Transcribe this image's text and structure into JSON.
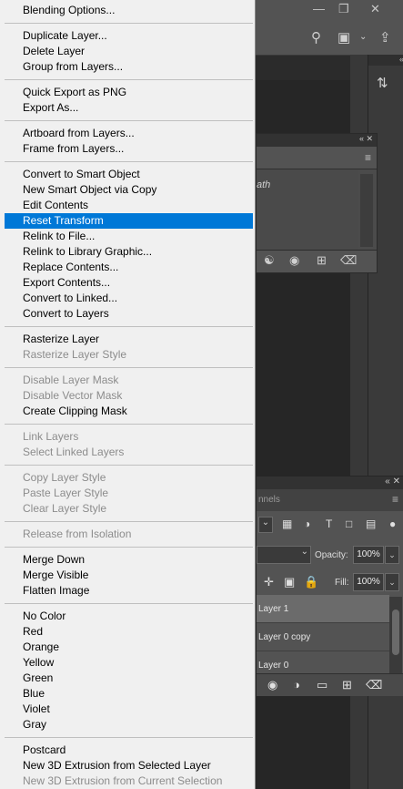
{
  "menu": {
    "items": [
      {
        "label": "Blending Options...",
        "state": "enabled"
      },
      {
        "label": "Duplicate Layer...",
        "state": "enabled"
      },
      {
        "label": "Delete Layer",
        "state": "enabled"
      },
      {
        "label": "Group from Layers...",
        "state": "enabled"
      },
      {
        "label": "Quick Export as PNG",
        "state": "enabled"
      },
      {
        "label": "Export As...",
        "state": "enabled"
      },
      {
        "label": "Artboard from Layers...",
        "state": "enabled"
      },
      {
        "label": "Frame from Layers...",
        "state": "enabled"
      },
      {
        "label": "Convert to Smart Object",
        "state": "enabled"
      },
      {
        "label": "New Smart Object via Copy",
        "state": "enabled"
      },
      {
        "label": "Edit Contents",
        "state": "enabled"
      },
      {
        "label": "Reset Transform",
        "state": "highlighted"
      },
      {
        "label": "Relink to File...",
        "state": "enabled"
      },
      {
        "label": "Relink to Library Graphic...",
        "state": "enabled"
      },
      {
        "label": "Replace Contents...",
        "state": "enabled"
      },
      {
        "label": "Export Contents...",
        "state": "enabled"
      },
      {
        "label": "Convert to Linked...",
        "state": "enabled"
      },
      {
        "label": "Convert to Layers",
        "state": "enabled"
      },
      {
        "label": "Rasterize Layer",
        "state": "enabled"
      },
      {
        "label": "Rasterize Layer Style",
        "state": "disabled"
      },
      {
        "label": "Disable Layer Mask",
        "state": "disabled"
      },
      {
        "label": "Disable Vector Mask",
        "state": "disabled"
      },
      {
        "label": "Create Clipping Mask",
        "state": "enabled"
      },
      {
        "label": "Link Layers",
        "state": "disabled"
      },
      {
        "label": "Select Linked Layers",
        "state": "disabled"
      },
      {
        "label": "Copy Layer Style",
        "state": "disabled"
      },
      {
        "label": "Paste Layer Style",
        "state": "disabled"
      },
      {
        "label": "Clear Layer Style",
        "state": "disabled"
      },
      {
        "label": "Release from Isolation",
        "state": "disabled"
      },
      {
        "label": "Merge Down",
        "state": "enabled"
      },
      {
        "label": "Merge Visible",
        "state": "enabled"
      },
      {
        "label": "Flatten Image",
        "state": "enabled"
      },
      {
        "label": "No Color",
        "state": "enabled"
      },
      {
        "label": "Red",
        "state": "enabled"
      },
      {
        "label": "Orange",
        "state": "enabled"
      },
      {
        "label": "Yellow",
        "state": "enabled"
      },
      {
        "label": "Green",
        "state": "enabled"
      },
      {
        "label": "Blue",
        "state": "enabled"
      },
      {
        "label": "Violet",
        "state": "enabled"
      },
      {
        "label": "Gray",
        "state": "enabled"
      },
      {
        "label": "Postcard",
        "state": "enabled"
      },
      {
        "label": "New 3D Extrusion from Selected Layer",
        "state": "enabled"
      },
      {
        "label": "New 3D Extrusion from Current Selection",
        "state": "disabled"
      }
    ]
  },
  "float_panel": {
    "list_text": "ath"
  },
  "layers_panel": {
    "tab_partial": "nnels",
    "opacity_label": "Opacity:",
    "opacity_value": "100%",
    "fill_label": "Fill:",
    "fill_value": "100%",
    "layers": [
      "Layer 1",
      "Layer 0 copy",
      "Layer 0"
    ],
    "selected_layer": "Layer 1"
  },
  "colors": {
    "menu_bg": "#f0f0f0",
    "highlight": "#0078d7",
    "disabled_text": "#8c8c8c",
    "app_bg": "#535353"
  }
}
